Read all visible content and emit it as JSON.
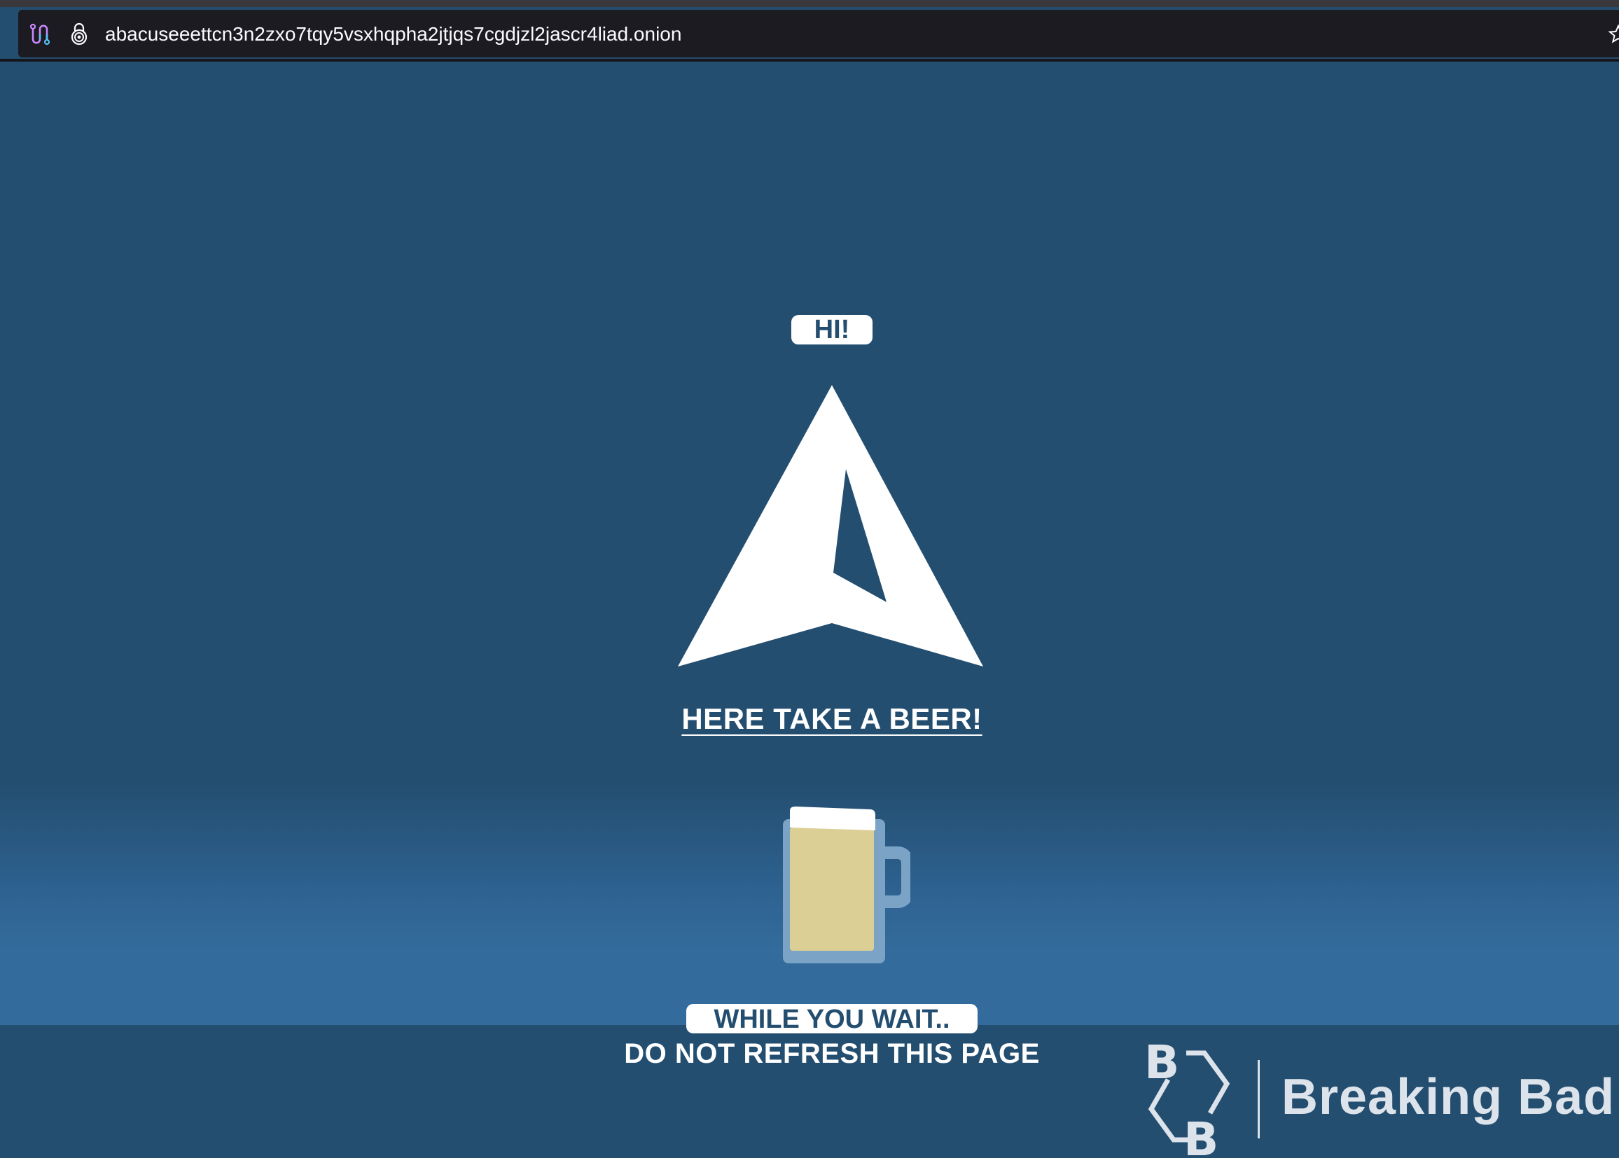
{
  "browser": {
    "url": "abacuseeettcn3n2zxo7tqy5vsxhqpha2jtjqs7cgdjzl2jascr4liad.onion",
    "icons": {
      "circuit": "tor-circuit-icon",
      "onion": "onion-lock-icon",
      "bookmark": "bookmark-star-icon"
    }
  },
  "page": {
    "greeting": "HI!",
    "beer_link": "HERE TAKE A BEER!",
    "wait_label": "WHILE YOU WAIT..",
    "notice": "DO NOT REFRESH THIS PAGE",
    "watermark_text": "Breaking Bad"
  },
  "colors": {
    "background": "#234e70",
    "band": "#336c9c",
    "beer": "#dccf96",
    "mug_glass": "#7aa3c6",
    "text": "#ffffff"
  }
}
